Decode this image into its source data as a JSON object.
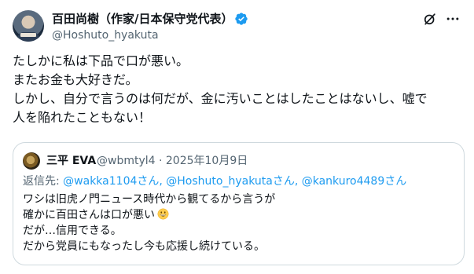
{
  "author": {
    "display_name": "百田尚樹（作家/日本保守党代表）",
    "handle": "@Hoshuto_hyakuta",
    "verified": true
  },
  "icons": {
    "verified": "verified-badge-icon",
    "grok": "grok-icon",
    "more": "more-options-icon"
  },
  "tweet": {
    "lines": [
      "たしかに私は下品で口が悪い。",
      "またお金も大好きだ。",
      "しかし、自分で言うのは何だが、金に汚いことはしたことはないし、嘘で",
      "人を陥れたこともない！"
    ]
  },
  "quote": {
    "display_name": "三平 EVA",
    "meta": "@wbmtyl4 · 2025年10月9日",
    "reply_prefix": "返信先: ",
    "reply_mentions": "@wakka1104さん, @Hoshuto_hyakutaさん, @kankuro4489さん",
    "lines": [
      "ワシは旧虎ノ門ニュース時代から観てるから言うが",
      "確かに百田さんは口が悪い",
      "だが…信用できる。",
      "だから党員にもなったし今も応援し続けている。"
    ],
    "emoji": "grinning-face-emoji"
  },
  "colors": {
    "text": "#0f1419",
    "secondary": "#536471",
    "accent": "#1d9bf0",
    "border": "#cfd9de"
  }
}
